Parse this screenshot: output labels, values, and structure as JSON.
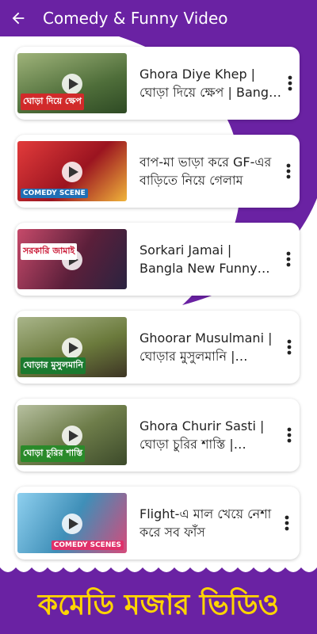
{
  "app_bar": {
    "title": "Comedy & Funny Video",
    "background": "#6a22a3",
    "back_icon": "arrow-left-icon"
  },
  "videos": [
    {
      "title": "Ghora Diye Khep | ঘোড়া দিয়ে ক্ষেপ | Bangla Comedy",
      "thumb_caption": "ঘোড়া দিয়ে ক্ষেপ",
      "thumb_color": "#5f8f4a"
    },
    {
      "title": "বাপ-মা ভাড়া করে GF-এর বাড়িতে নিয়ে গেলাম",
      "thumb_caption": "COMEDY SCENE",
      "thumb_color": "#b2232a"
    },
    {
      "title": "Sorkari Jamai | Bangla New Funny Video",
      "thumb_caption": "সরকারি জামাই",
      "thumb_color": "#7a1f3d"
    },
    {
      "title": "Ghoorar Musulmani | ঘোড়ার মুসুলমানি | Comedy",
      "thumb_caption": "ঘোড়ার মুসুলমানি",
      "thumb_color": "#6b7a3c"
    },
    {
      "title": "Ghora Churir Sasti | ঘোড়া চুরির শাস্তি | Comedy",
      "thumb_caption": "ঘোড়া চুরির শাস্তি",
      "thumb_color": "#556b2f"
    },
    {
      "title": "Flight-এ মাল খেয়ে নেশা করে সব ফাঁস",
      "thumb_caption": "COMEDY SCENES",
      "thumb_color": "#3f8fb8"
    }
  ],
  "banner": {
    "text": "কমেডি মজার ভিডিও",
    "text_color": "#ffd400"
  }
}
